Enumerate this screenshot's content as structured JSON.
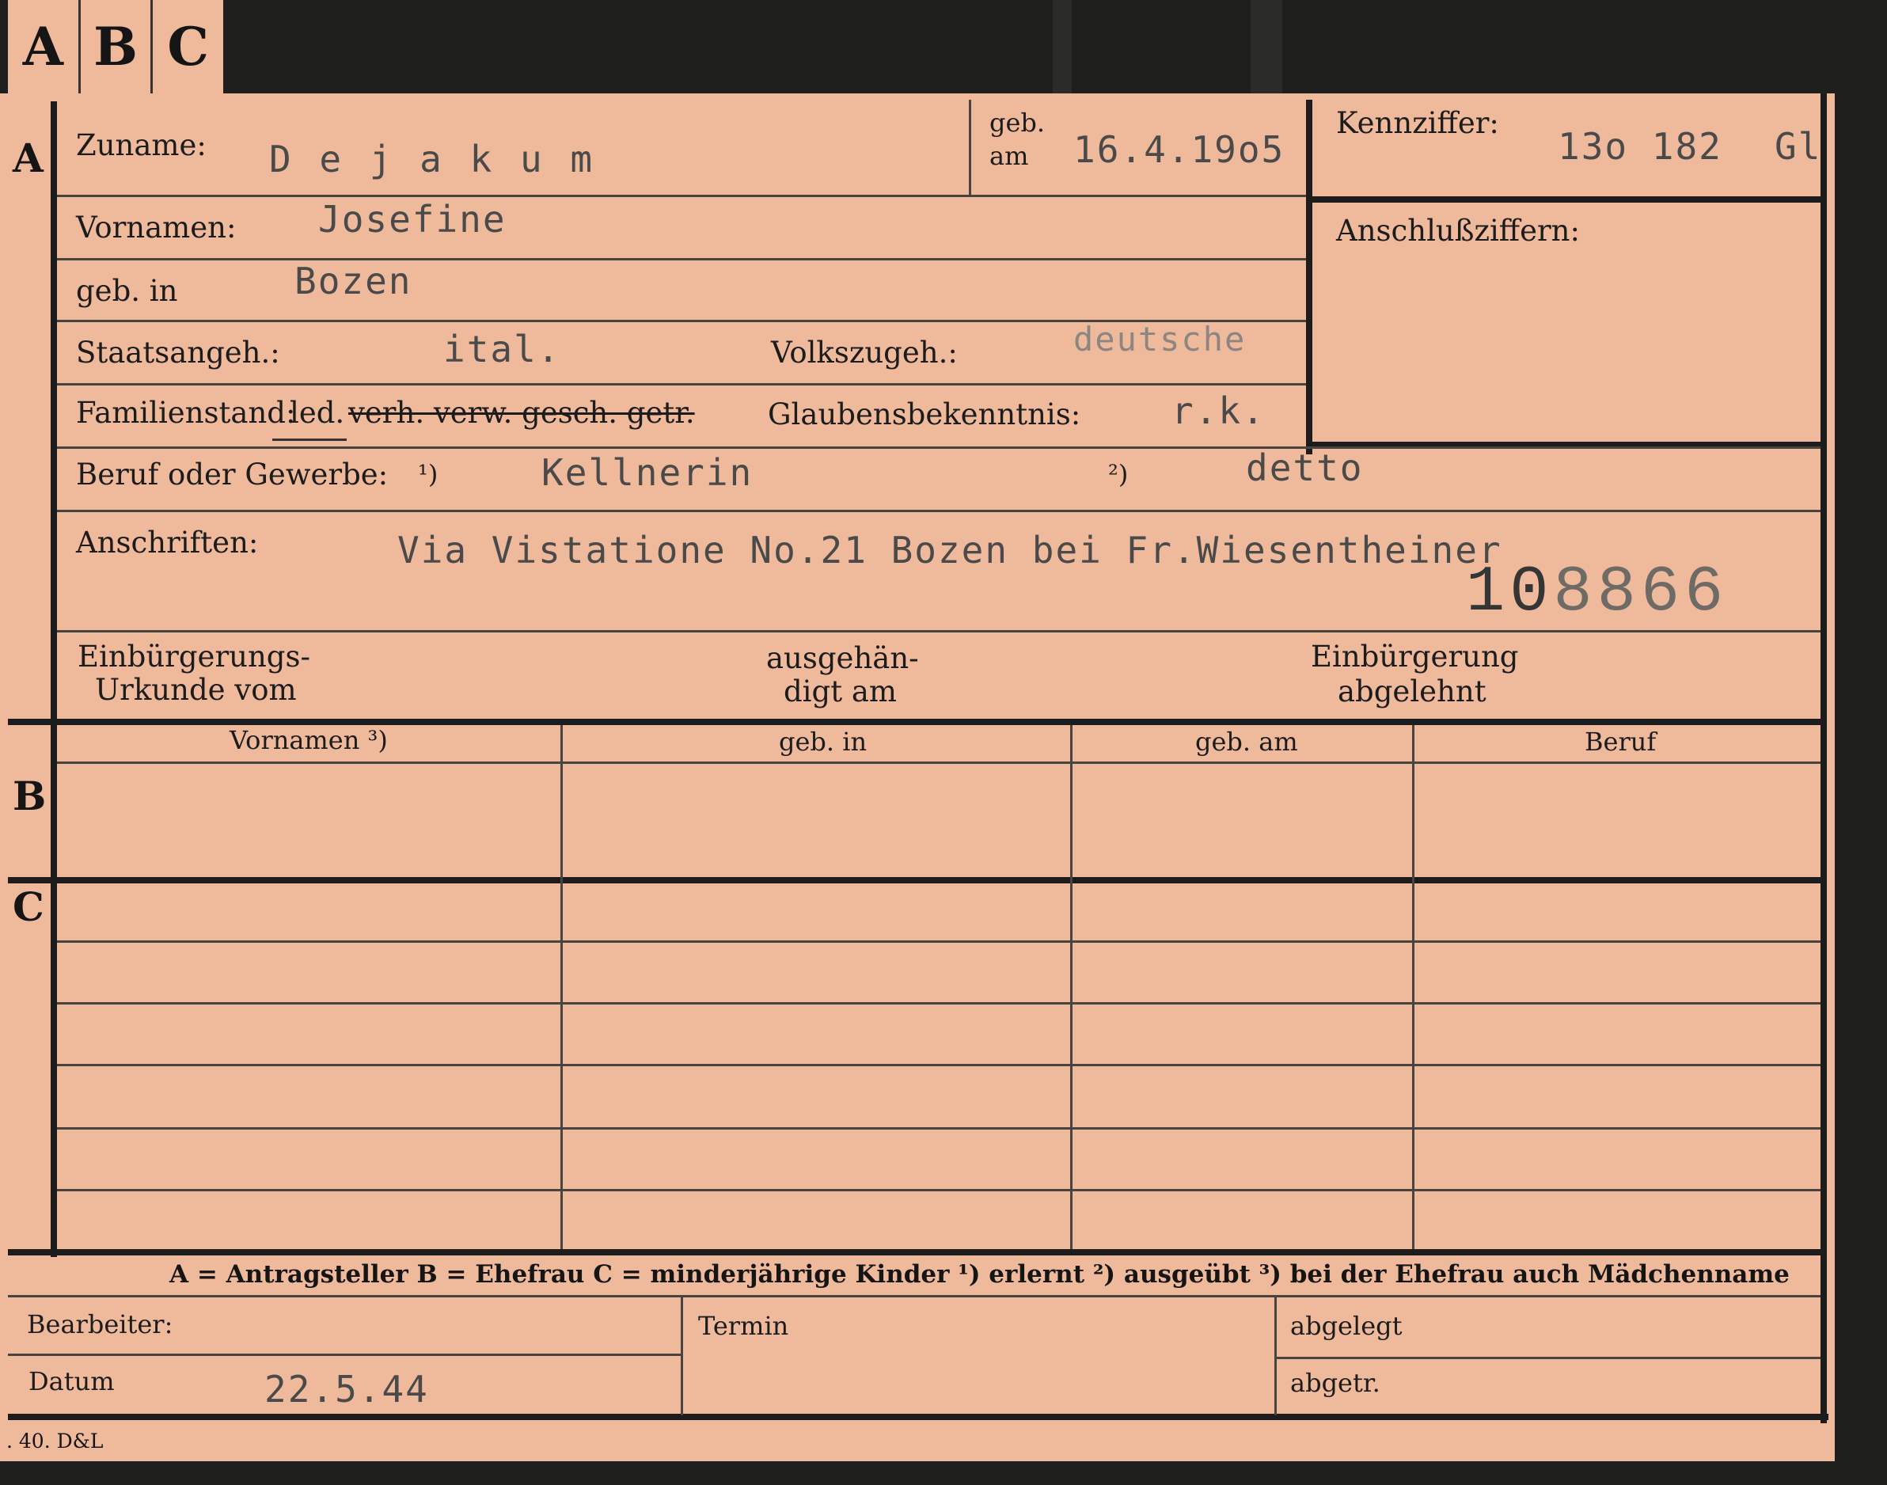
{
  "tabs": [
    "A",
    "B",
    "C"
  ],
  "sections": {
    "a": "A",
    "b": "B",
    "c": "C"
  },
  "fields": {
    "zuname_label": "Zuname:",
    "zuname_value": "D e j a k u m",
    "geb_am_label_1": "geb.",
    "geb_am_label_2": "am",
    "geb_am_value": "16.4.19o5",
    "kennziffer_label": "Kennziffer:",
    "kennziffer_value": "13o 182",
    "kennziffer_suffix": "Gl",
    "anschlussziffern_label": "Anschlußziffern:",
    "vornamen_label": "Vornamen:",
    "vornamen_value": "Josefine",
    "geb_in_label": "geb. in",
    "geb_in_value": "Bozen",
    "staatsangeh_label": "Staatsangeh.:",
    "staatsangeh_value": "ital.",
    "volkszugeh_label": "Volkszugeh.:",
    "volkszugeh_value": "deutsche",
    "familienstand_label": "Familienstand:",
    "familienstand_led": "led.",
    "familienstand_struck": "verh. verw. gesch. getr.",
    "glaubensbekenntnis_label": "Glaubensbekenntnis:",
    "glaubensbekenntnis_value": "r.k.",
    "beruf_label": "Beruf oder Gewerbe:",
    "beruf_mark_1": "¹)",
    "beruf_value_1": "Kellnerin",
    "beruf_mark_2": "²)",
    "beruf_value_2": "detto",
    "anschriften_label": "Anschriften:",
    "anschriften_value": "Via Vistatione No.21 Bozen bei Fr.Wiesentheiner",
    "stamp_number_a": "10",
    "stamp_number_b": "8866",
    "einb_urkunde_1": "Einbürgerungs-",
    "einb_urkunde_2": "Urkunde vom",
    "ausgehaendigt_1": "ausgehän-",
    "ausgehaendigt_2": "digt am",
    "einb_abgelehnt_1": "Einbürgerung",
    "einb_abgelehnt_2": "abgelehnt"
  },
  "table_headers": [
    "Vornamen ³)",
    "geb. in",
    "geb. am",
    "Beruf"
  ],
  "legend": "A = Antragsteller   B = Ehefrau   C = minderjährige Kinder   ¹) erlernt   ²) ausgeübt   ³) bei der Ehefrau auch Mädchenname",
  "bottom": {
    "bearbeiter_label": "Bearbeiter:",
    "datum_label": "Datum",
    "datum_value": "22.5.44",
    "termin_label": "Termin",
    "abgelegt_label": "abgelegt",
    "abgetr_label": "abgetr."
  },
  "footer": ". 40. D&L"
}
